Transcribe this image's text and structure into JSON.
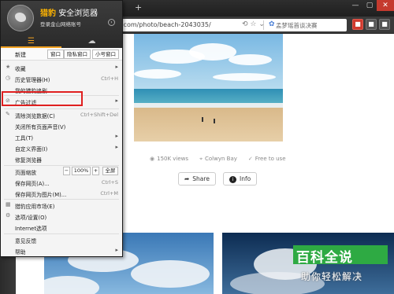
{
  "browser": {
    "new_tab": "+",
    "url_fragment": ".com/photo/beach-2043035/",
    "url_icons": "⟲ ☆ ⌄",
    "search_placeholder": "孟梦瑶首谈决赛",
    "window_controls": [
      "—",
      "▢",
      "✕"
    ],
    "ext_icons": [
      "■",
      "■",
      "■"
    ]
  },
  "menu": {
    "brand_prefix": "猎豹",
    "brand_suffix": "安全浏览器",
    "account": "登录金山网络账号",
    "account_arrow": "›",
    "new_label": "新建",
    "new_buttons": [
      "窗口",
      "隐私窗口",
      "小号窗口"
    ],
    "items": [
      {
        "icon": "★",
        "label": "收藏",
        "shortcut": "",
        "arrow": "▸"
      },
      {
        "icon": "◷",
        "label": "历史管理器(H)",
        "shortcut": "Ctrl+H",
        "arrow": ""
      },
      {
        "icon": "",
        "label": "我的猎豹追剧",
        "shortcut": "",
        "arrow": ""
      },
      {
        "icon": "⊘",
        "label": "广告过滤",
        "shortcut": "",
        "arrow": "▸"
      },
      {
        "icon": "✎",
        "label": "清除浏览数据(C)",
        "shortcut": "Ctrl+Shift+Del",
        "arrow": ""
      },
      {
        "icon": "",
        "label": "关闭所有页面声音(V)",
        "shortcut": "",
        "arrow": ""
      },
      {
        "icon": "",
        "label": "工具(T)",
        "shortcut": "",
        "arrow": "▸"
      },
      {
        "icon": "",
        "label": "自定义界面(I)",
        "shortcut": "",
        "arrow": "▸"
      },
      {
        "icon": "",
        "label": "修复浏览器",
        "shortcut": "",
        "arrow": ""
      },
      {
        "icon": "",
        "label": "保存网页(A)...",
        "shortcut": "Ctrl+S",
        "arrow": ""
      },
      {
        "icon": "",
        "label": "保存网页为图片(M)...",
        "shortcut": "Ctrl+M",
        "arrow": ""
      },
      {
        "icon": "▦",
        "label": "猎豹应用市场(E)",
        "shortcut": "",
        "arrow": ""
      },
      {
        "icon": "⚙",
        "label": "选项/设置(O)",
        "shortcut": "",
        "arrow": ""
      },
      {
        "icon": "",
        "label": "Internet选项",
        "shortcut": "",
        "arrow": ""
      },
      {
        "icon": "",
        "label": "意见反馈",
        "shortcut": "",
        "arrow": ""
      },
      {
        "icon": "",
        "label": "帮助",
        "shortcut": "",
        "arrow": "▸"
      }
    ],
    "zoom": {
      "label": "页面缩放",
      "minus": "−",
      "value": "100%",
      "plus": "+",
      "full": "全屏"
    }
  },
  "photo": {
    "views": "150K views",
    "location": "Colwyn Bay",
    "license": "Free to use",
    "share_label": "Share",
    "info_label": "Info",
    "icons": {
      "views": "◉",
      "location": "⌖",
      "license": "✓",
      "share": "➦",
      "info": "i"
    }
  },
  "watermark": {
    "title": "百科全说",
    "subtitle": "助你轻松解决"
  },
  "colors": {
    "accent": "#f0a020",
    "highlight": "#e02020",
    "watermark": "#2eaa43"
  }
}
